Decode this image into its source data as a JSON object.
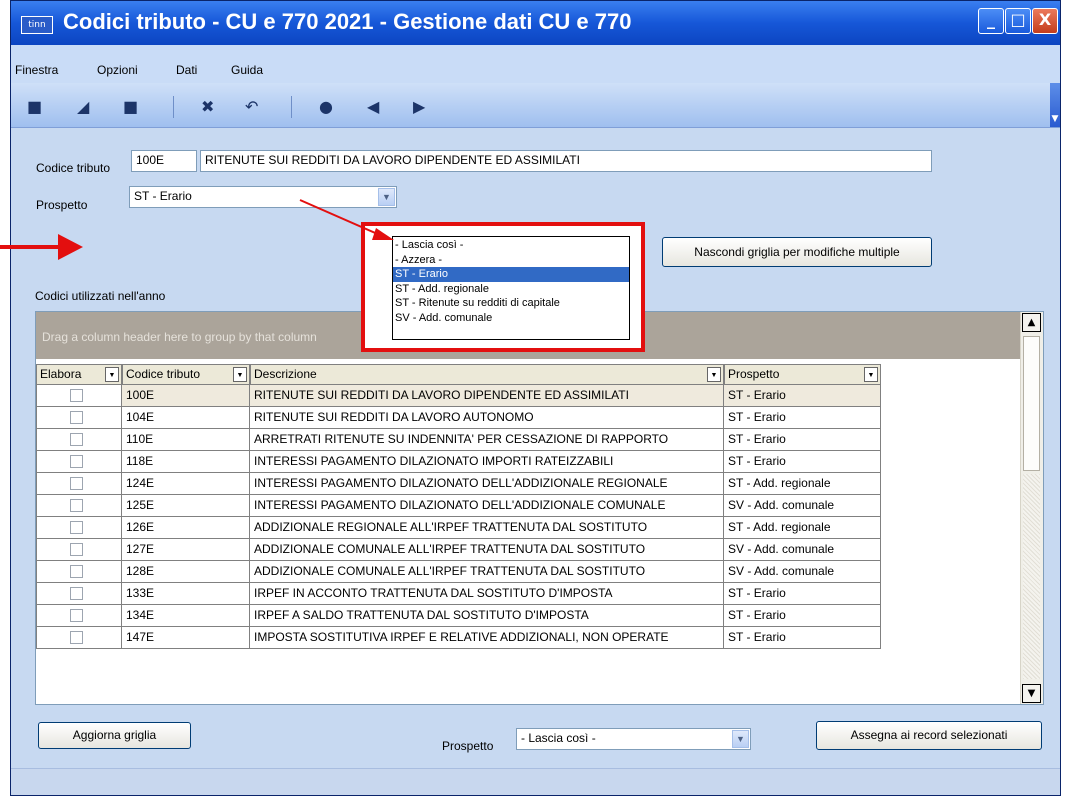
{
  "window": {
    "title": "Codici tributo - CU e 770 2021 - Gestione dati CU e 770",
    "icon_label": "tinn",
    "controls": {
      "minimize": "_",
      "maximize": "□",
      "close": "X"
    }
  },
  "menu": [
    "Finestra",
    "Opzioni",
    "Dati",
    "Guida"
  ],
  "toolbar": {
    "icons": [
      "new-icon",
      "save-icon",
      "stop-icon",
      "delete-icon",
      "undo-icon",
      "search-icon",
      "back-arrow-icon",
      "forward-arrow-icon"
    ]
  },
  "form": {
    "codice_label": "Codice tributo",
    "codice_value": "100E",
    "descrizione_value": "RITENUTE SUI REDDITI DA LAVORO DIPENDENTE ED ASSIMILATI",
    "prospetto_label": "Prospetto",
    "prospetto_value": "ST - Erario",
    "hide_grid_button": "Nascondi griglia per modifiche multiple"
  },
  "dropdown": {
    "options": [
      "- Lascia così -",
      "- Azzera -",
      "ST - Erario",
      "ST - Add. regionale",
      "ST - Ritenute su redditi di capitale",
      "SV - Add. comunale"
    ],
    "selected": "ST - Erario"
  },
  "grid": {
    "section_label": "Codici utilizzati nell'anno",
    "group_hint": "Drag a column header here to group by that column",
    "columns": [
      "Elabora",
      "Codice tributo",
      "Descrizione",
      "Prospetto"
    ],
    "rows": [
      {
        "codice": "100E",
        "descrizione": "RITENUTE SUI REDDITI DA LAVORO DIPENDENTE ED ASSIMILATI",
        "prospetto": "ST - Erario"
      },
      {
        "codice": "104E",
        "descrizione": "RITENUTE SUI REDDITI DA LAVORO AUTONOMO",
        "prospetto": "ST - Erario"
      },
      {
        "codice": "110E",
        "descrizione": "ARRETRATI RITENUTE SU INDENNITA' PER CESSAZIONE DI RAPPORTO",
        "prospetto": "ST - Erario"
      },
      {
        "codice": "118E",
        "descrizione": "INTERESSI PAGAMENTO DILAZIONATO IMPORTI RATEIZZABILI",
        "prospetto": "ST - Erario"
      },
      {
        "codice": "124E",
        "descrizione": "INTERESSI PAGAMENTO DILAZIONATO DELL'ADDIZIONALE REGIONALE",
        "prospetto": "ST - Add. regionale"
      },
      {
        "codice": "125E",
        "descrizione": "INTERESSI PAGAMENTO DILAZIONATO DELL'ADDIZIONALE COMUNALE",
        "prospetto": "SV - Add. comunale"
      },
      {
        "codice": "126E",
        "descrizione": "ADDIZIONALE REGIONALE ALL'IRPEF TRATTENUTA DAL SOSTITUTO",
        "prospetto": "ST - Add. regionale"
      },
      {
        "codice": "127E",
        "descrizione": "ADDIZIONALE COMUNALE ALL'IRPEF TRATTENUTA DAL SOSTITUTO",
        "prospetto": "SV - Add. comunale"
      },
      {
        "codice": "128E",
        "descrizione": "ADDIZIONALE COMUNALE ALL'IRPEF TRATTENUTA DAL SOSTITUTO",
        "prospetto": "SV - Add. comunale"
      },
      {
        "codice": "133E",
        "descrizione": "IRPEF IN ACCONTO TRATTENUTA DAL SOSTITUTO D'IMPOSTA",
        "prospetto": "ST - Erario"
      },
      {
        "codice": "134E",
        "descrizione": "IRPEF A SALDO TRATTENUTA DAL SOSTITUTO D'IMPOSTA",
        "prospetto": "ST - Erario"
      },
      {
        "codice": "147E",
        "descrizione": "IMPOSTA SOSTITUTIVA IRPEF E RELATIVE ADDIZIONALI, NON OPERATE",
        "prospetto": "ST - Erario"
      }
    ]
  },
  "bottom": {
    "refresh_button": "Aggiorna griglia",
    "prospetto_label": "Prospetto",
    "prospetto_value": "- Lascia così -",
    "assign_button": "Assegna ai record selezionati"
  },
  "colors": {
    "annotation_red": "#e30f0f",
    "selection_blue": "#316ac5",
    "title_blue": "#1657d8"
  }
}
